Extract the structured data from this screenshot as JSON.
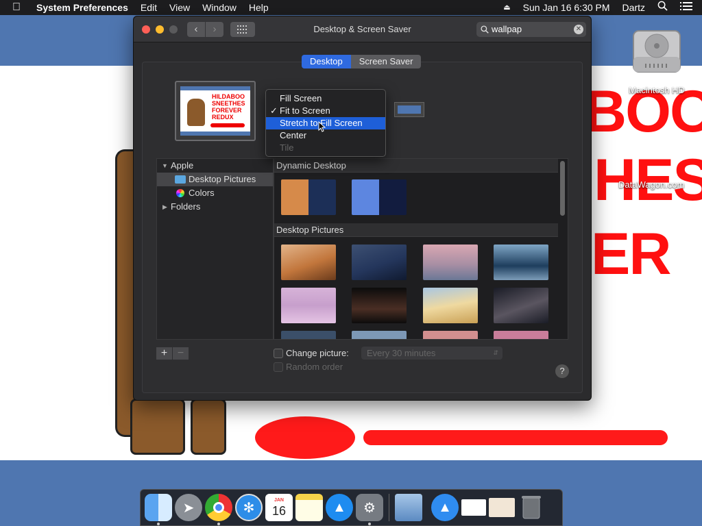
{
  "menubar": {
    "app_name": "System Preferences",
    "items": [
      "Edit",
      "View",
      "Window",
      "Help"
    ],
    "clock": "Sun Jan 16  6:30 PM",
    "user": "Dartz"
  },
  "desktop": {
    "drive_label": "Macintosh HD",
    "watermark": "DataWagon.com",
    "wall_text_1": "BOO",
    "wall_text_2": "HES",
    "wall_text_3": "ER"
  },
  "window": {
    "title": "Desktop & Screen Saver",
    "search_value": "wallpap",
    "tabs": [
      {
        "label": "Desktop",
        "active": true
      },
      {
        "label": "Screen Saver",
        "active": false
      }
    ],
    "preview_text": [
      "HILDABOO",
      "SNEETHES",
      "FOREVER",
      "REDUX"
    ],
    "fit_menu": {
      "options": [
        {
          "label": "Fill Screen",
          "checked": false,
          "highlighted": false,
          "disabled": false
        },
        {
          "label": "Fit to Screen",
          "checked": true,
          "highlighted": false,
          "disabled": false
        },
        {
          "label": "Stretch to Fill Screen",
          "checked": false,
          "highlighted": true,
          "disabled": false
        },
        {
          "label": "Center",
          "checked": false,
          "highlighted": false,
          "disabled": false
        },
        {
          "label": "Tile",
          "checked": false,
          "highlighted": false,
          "disabled": true
        }
      ]
    },
    "sidebar": {
      "group": "Apple",
      "items": [
        "Desktop Pictures",
        "Colors"
      ],
      "folders": "Folders"
    },
    "sections": {
      "dynamic": "Dynamic Desktop",
      "pictures": "Desktop Pictures"
    },
    "change_picture_label": "Change picture:",
    "interval": "Every 30 minutes",
    "random_order_label": "Random order",
    "help": "?"
  },
  "dock": {
    "calendar_month": "JAN",
    "calendar_day": "16"
  },
  "colors": {
    "accent": "#1e5fd8",
    "desktop_blue": "#4f76b0",
    "paint_red": "#ff1a1a"
  }
}
